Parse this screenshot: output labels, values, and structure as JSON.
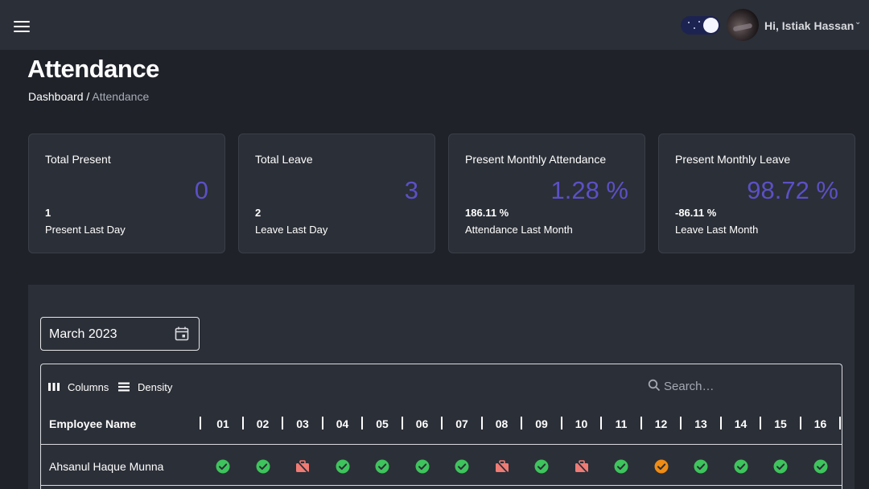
{
  "header": {
    "user_greeting": "Hi, Istiak Hassan",
    "theme_toggle": "dark-mode-on"
  },
  "page": {
    "title": "Attendance",
    "breadcrumb": {
      "root": "Dashboard",
      "separator": "/",
      "current": "Attendance"
    }
  },
  "stats": [
    {
      "title": "Total Present",
      "value": "0",
      "sub_value": "1",
      "sub_label": "Present Last Day"
    },
    {
      "title": "Total Leave",
      "value": "3",
      "sub_value": "2",
      "sub_label": "Leave Last Day"
    },
    {
      "title": "Present Monthly Attendance",
      "value": "1.28 %",
      "sub_value": "186.11 %",
      "sub_label": "Attendance Last Month"
    },
    {
      "title": "Present Monthly Leave",
      "value": "98.72 %",
      "sub_value": "-86.11 %",
      "sub_label": "Leave Last Month"
    }
  ],
  "filters": {
    "month": "March 2023"
  },
  "toolbar": {
    "columns_label": "Columns",
    "density_label": "Density",
    "search_placeholder": "Search…"
  },
  "table": {
    "employee_header": "Employee Name",
    "days": [
      "01",
      "02",
      "03",
      "04",
      "05",
      "06",
      "07",
      "08",
      "09",
      "10",
      "11",
      "12",
      "13",
      "14",
      "15",
      "16"
    ],
    "rows": [
      {
        "name": "Ahsanul Haque Munna",
        "statuses": [
          "present",
          "present",
          "leave",
          "present",
          "present",
          "present",
          "present",
          "leave",
          "present",
          "leave",
          "present",
          "late",
          "present",
          "present",
          "present",
          "present"
        ]
      }
    ]
  },
  "colors": {
    "accent": "#5b50c6",
    "present": "#3ec45c",
    "leave": "#ef7b74",
    "late": "#f08c14"
  }
}
